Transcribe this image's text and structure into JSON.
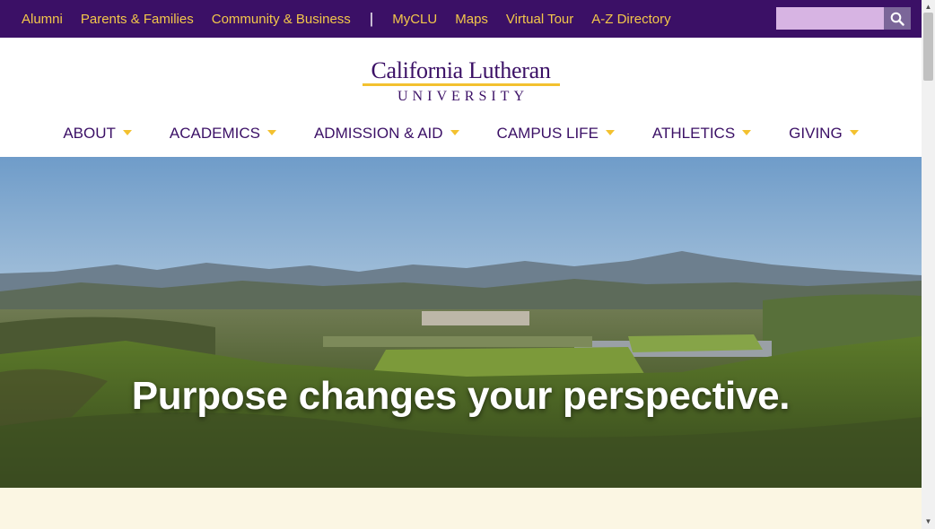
{
  "utility_nav": {
    "links": [
      "Alumni",
      "Parents & Families",
      "Community & Business"
    ],
    "separator": "|",
    "links2": [
      "MyCLU",
      "Maps",
      "Virtual Tour",
      "A-Z Directory"
    ]
  },
  "search": {
    "value": "",
    "placeholder": ""
  },
  "logo": {
    "name": "California Lutheran",
    "sub": "UNIVERSITY"
  },
  "main_nav": [
    "ABOUT",
    "ACADEMICS",
    "ADMISSION & AID",
    "CAMPUS LIFE",
    "ATHLETICS",
    "GIVING"
  ],
  "hero": {
    "title": "Purpose changes your perspective."
  },
  "colors": {
    "brand_purple": "#3b1066",
    "brand_gold": "#f3c12f",
    "cream": "#fbf6e3"
  },
  "icons": {
    "search": "search-icon",
    "nav_caret": "caret-down-icon",
    "scroll_up": "scroll-up-icon",
    "scroll_down": "scroll-down-icon"
  }
}
